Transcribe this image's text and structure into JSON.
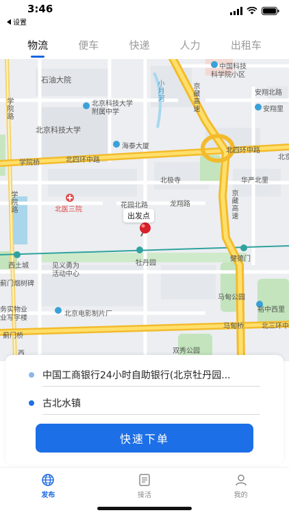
{
  "status_bar": {
    "time": "3:46",
    "back_label": "设置"
  },
  "tabs": [
    {
      "label": "物流",
      "active": true
    },
    {
      "label": "便车",
      "active": false
    },
    {
      "label": "快递",
      "active": false
    },
    {
      "label": "人力",
      "active": false
    },
    {
      "label": "出租车",
      "active": false
    }
  ],
  "map": {
    "origin_label": "出发点",
    "places": {
      "shiyou": "石油大院",
      "zhongguo_keji": "中国科技",
      "keji_xiaoqu": "科学院小区",
      "anxiang_bei": "安翔北路",
      "xueyuan_lu": "学院路",
      "bjkd_fushu": "北京科技大学",
      "bjkd_fushu2": "附属中学",
      "anxiang_li": "安翔里",
      "bjkd": "北京科技大学",
      "haitai": "海泰大厦",
      "jingzang_top": "京藏高速",
      "bei4_left": "北四环中路",
      "bei4_right": "北四环中路",
      "bei_cut": "北京",
      "xueyuanqiao": "学院桥",
      "beiji": "北极寺",
      "huayan": "华严北里",
      "xueyuan_lu2": "学院路",
      "beiyi": "北医三院",
      "huayuanbei": "花园北路",
      "longxiang": "龙翔路",
      "jingzang_mid": "京藏高速",
      "xitucheng": "西土城",
      "jianyi": "见义勇为",
      "jianyi2": "活动中心",
      "mudanyuan": "牡丹园",
      "jiande": "健德门",
      "jimen": "蓟门烟树碑",
      "madian_park": "马甸公园",
      "wuye": "务实物业",
      "wuye2": "业写字楼",
      "dianying": "北京电影制片厂",
      "yuzhong": "裕中西里",
      "jimenqiao": "蓟门桥",
      "madianqiao": "马甸桥",
      "bei3": "北三环中",
      "xi": "西",
      "shuangxiu": "双秀公园",
      "xiaoyuehe": "小月河"
    }
  },
  "order": {
    "start": "中国工商银行24小时自助银行(北京牡丹园...",
    "end": "古北水镇",
    "start_dot_color": "#8fb4ee",
    "end_dot_color": "#1c6fe6",
    "submit_label": "快速下单"
  },
  "nav": [
    {
      "label": "发布",
      "icon": "globe-icon",
      "active": true
    },
    {
      "label": "接活",
      "icon": "document-icon",
      "active": false
    },
    {
      "label": "我的",
      "icon": "user-icon",
      "active": false
    }
  ],
  "colors": {
    "accent": "#1c6fe6",
    "highway": "#f7c638",
    "park": "#b9e0b0",
    "water": "#a8d8ee"
  }
}
